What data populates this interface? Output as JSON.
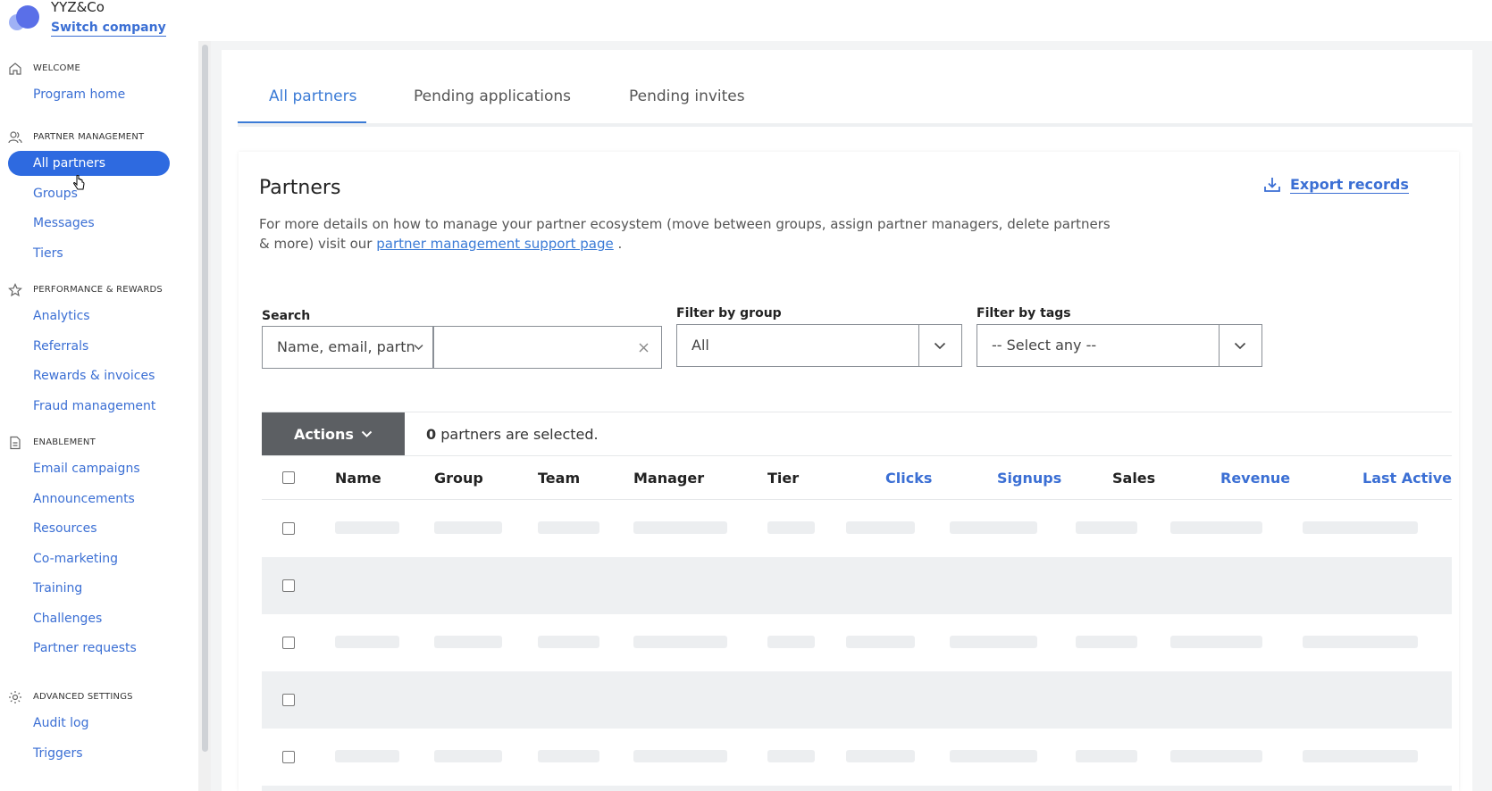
{
  "company": {
    "name": "YYZ&Co",
    "switch_label": "Switch company"
  },
  "sidebar": {
    "sections": [
      {
        "title": "WELCOME",
        "icon": "home-icon",
        "items": [
          {
            "label": "Program home"
          }
        ]
      },
      {
        "title": "PARTNER MANAGEMENT",
        "icon": "users-icon",
        "items": [
          {
            "label": "All partners",
            "active": true
          },
          {
            "label": "Groups"
          },
          {
            "label": "Messages"
          },
          {
            "label": "Tiers"
          }
        ]
      },
      {
        "title": "PERFORMANCE & REWARDS",
        "icon": "star-icon",
        "items": [
          {
            "label": "Analytics"
          },
          {
            "label": "Referrals"
          },
          {
            "label": "Rewards & invoices"
          },
          {
            "label": "Fraud management"
          }
        ]
      },
      {
        "title": "ENABLEMENT",
        "icon": "document-icon",
        "items": [
          {
            "label": "Email campaigns"
          },
          {
            "label": "Announcements"
          },
          {
            "label": "Resources"
          },
          {
            "label": "Co-marketing"
          },
          {
            "label": "Training"
          },
          {
            "label": "Challenges"
          },
          {
            "label": "Partner requests"
          }
        ]
      },
      {
        "title": "ADVANCED SETTINGS",
        "icon": "gear-icon",
        "items": [
          {
            "label": "Audit log"
          },
          {
            "label": "Triggers"
          }
        ]
      }
    ]
  },
  "tabs": [
    {
      "label": "All partners",
      "active": true
    },
    {
      "label": "Pending applications"
    },
    {
      "label": "Pending invites"
    }
  ],
  "card": {
    "title": "Partners",
    "desc_before": "For more details on how to manage your partner ecosystem (move between groups, assign partner managers, delete partners & more) visit our ",
    "desc_link": "partner management support page",
    "desc_after": " .",
    "export_label": "Export records"
  },
  "filters": {
    "search_label": "Search",
    "search_type": "Name, email, partn",
    "search_value": "",
    "group_label": "Filter by group",
    "group_value": "All",
    "tags_label": "Filter by tags",
    "tags_value": "-- Select any --"
  },
  "actions": {
    "button_label": "Actions",
    "selected_count": "0",
    "selected_text": " partners are selected."
  },
  "table": {
    "headers": [
      "Name",
      "Group",
      "Team",
      "Manager",
      "Tier",
      "Clicks",
      "Signups",
      "Sales",
      "Revenue",
      "Last Active"
    ]
  },
  "colors": {
    "accent": "#3b6fd4",
    "active_pill": "#2e6ae0",
    "actions_bg": "#5c5f63"
  }
}
